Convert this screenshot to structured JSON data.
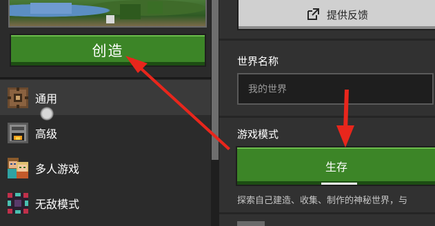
{
  "left_panel": {
    "create_button_label": "创造",
    "nav_items": [
      {
        "label": "通用",
        "icon": "gear-block-icon",
        "selected": true
      },
      {
        "label": "高级",
        "icon": "furnace-icon",
        "selected": false
      },
      {
        "label": "多人游戏",
        "icon": "players-icon",
        "selected": false
      },
      {
        "label": "无敌模式",
        "icon": "cheats-icon",
        "selected": false
      }
    ]
  },
  "right_panel": {
    "feedback_button_label": "提供反馈",
    "world_name_label": "世界名称",
    "world_name_placeholder": "我的世界",
    "game_mode_label": "游戏模式",
    "game_mode_value": "生存",
    "game_mode_description": "探索自己建造、收集、制作的神秘世界，与"
  },
  "colors": {
    "primary_green": "#3c8527",
    "annotation_arrow": "#e8261c"
  }
}
